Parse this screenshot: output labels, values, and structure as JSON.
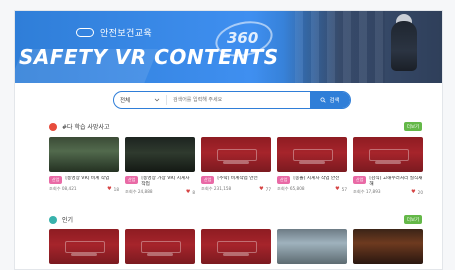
{
  "hero": {
    "brand": "안전보건교육",
    "title": "SAFETY VR CONTENTS",
    "badge_360": "360"
  },
  "search": {
    "select_value": "전체",
    "placeholder": "검색어를 입력해 주세요",
    "button": "검색"
  },
  "sections": [
    {
      "title": "#다 학습 사망사고",
      "more": "더보기",
      "cards": [
        {
          "badge": "산업",
          "title": "[동영상 VR] 비계 작업",
          "views": "조회수 08,421",
          "likes": "18",
          "thumb": "photo1"
        },
        {
          "badge": "산업",
          "title": "[동영상 가상 VR] 지게차 작업",
          "views": "조회수 24,888",
          "likes": "8",
          "thumb": "photo2"
        },
        {
          "badge": "산업",
          "title": "[추락] 비계작업 안전",
          "views": "조회수 231,158",
          "likes": "77",
          "thumb": "red"
        },
        {
          "badge": "산업",
          "title": "[충돌] 지게차 작업 안전",
          "views": "조회수 65,808",
          "likes": "57",
          "thumb": "red"
        },
        {
          "badge": "산업",
          "title": "[감식] 고해수러처리 질식재해",
          "views": "조회수 17,893",
          "likes": "20",
          "thumb": "red"
        }
      ]
    },
    {
      "title": "인기",
      "more": "더보기",
      "cards": [
        {
          "badge": "",
          "title": "",
          "views": "",
          "likes": "",
          "thumb": "red"
        },
        {
          "badge": "",
          "title": "",
          "views": "",
          "likes": "",
          "thumb": "red"
        },
        {
          "badge": "",
          "title": "",
          "views": "",
          "likes": "",
          "thumb": "red"
        },
        {
          "badge": "",
          "title": "",
          "views": "",
          "likes": "",
          "thumb": "photo3"
        },
        {
          "badge": "",
          "title": "",
          "views": "",
          "likes": "",
          "thumb": "photo4"
        }
      ]
    }
  ],
  "colors": {
    "brand_blue": "#2f7ed8",
    "badge_pink": "#e96aa6",
    "more_green": "#64b848",
    "accent_red": "#e74c3c",
    "accent_teal": "#38b2ac"
  }
}
